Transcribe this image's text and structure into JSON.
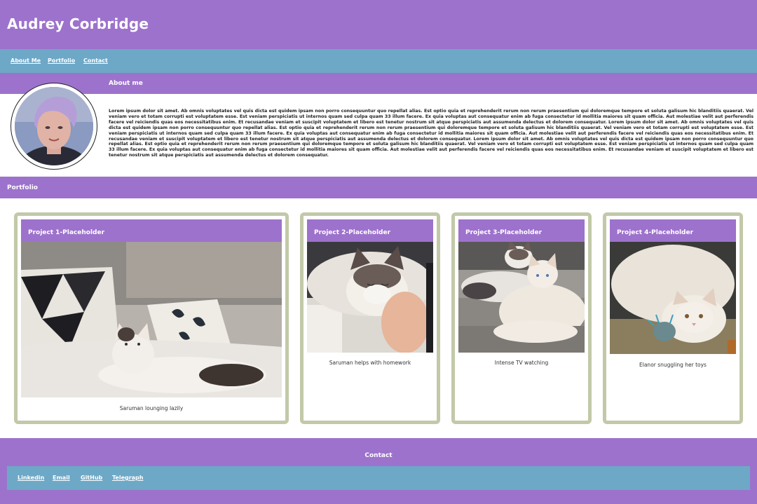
{
  "header": {
    "title": "Audrey Corbridge"
  },
  "nav": {
    "items": [
      {
        "label": "About Me"
      },
      {
        "label": "Portfolio"
      },
      {
        "label": "Contact"
      }
    ]
  },
  "about": {
    "heading": "About me",
    "avatar_icon": "profile-photo",
    "text": "Lorem ipsum dolor sit amet. Ab omnis voluptates vel quis dicta est quidem ipsam non porro consequuntur quo repellat alias. Est optio quia et reprehenderit rerum non rerum praesentium qui doloremque tempore et soluta galisum hic blanditiis quaerat. Vel veniam vero et totam corrupti est voluptatem esse. Est veniam perspiciatis ut internos quam sed culpa quam 33 illum facere. Ex quia voluptas aut consequatur enim ab fuga consectetur id mollitia maiores sit quam officia. Aut molestiae velit aut perferendis facere vel reiciendis quas eos necessitatibus enim. Et recusandae veniam et suscipit voluptatem et libero est tenetur nostrum sit atque perspiciatis aut assumenda delectus et dolorem consequatur. Lorem ipsum dolor sit amet. Ab omnis voluptates vel quis dicta est quidem ipsam non porro consequuntur quo repellat alias. Est optio quia et reprehenderit rerum non rerum praesentium qui doloremque tempore et soluta galisum hic blanditiis quaerat. Vel veniam vero et totam corrupti est voluptatem esse. Est veniam perspiciatis ut internos quam sed culpa quam 33 illum facere. Ex quia voluptas aut consequatur enim ab fuga consectetur id mollitia maiores sit quam officia. Aut molestiae velit aut perferendis facere vel reiciendis quas eos necessitatibus enim. Et recusandae veniam et suscipit voluptatem et libero est tenetur nostrum sit atque perspiciatis aut assumenda delectus et dolorem consequatur. Lorem ipsum dolor sit amet. Ab omnis voluptates vel quis dicta est quidem ipsam non porro consequuntur quo repellat alias. Est optio quia et reprehenderit rerum non rerum praesentium qui doloremque tempore et soluta galisum hic blanditiis quaerat. Vel veniam vero et totam corrupti est voluptatem esse. Est veniam perspiciatis ut internos quam sed culpa quam 33 illum facere. Ex quia voluptas aut consequatur enim ab fuga consectetur id mollitia maiores sit quam officia. Aut molestiae velit aut perferendis facere vel reiciendis quas eos necessitatibus enim. Et recusandae veniam et suscipit voluptatem et libero est tenetur nostrum sit atque perspiciatis aut assumenda delectus et dolorem consequatur."
  },
  "portfolio": {
    "heading": "Portfolio",
    "projects": [
      {
        "title": "Project 1-Placeholder",
        "caption": "Saruman lounging lazily"
      },
      {
        "title": "Project 2-Placeholder",
        "caption": "Saruman helps with homework"
      },
      {
        "title": "Project 3-Placeholder",
        "caption": "Intense TV watching"
      },
      {
        "title": "Project 4-Placeholder",
        "caption": "Elanor snuggling her toys"
      }
    ]
  },
  "footer": {
    "heading": "Contact",
    "links": [
      {
        "label": "Linkedin"
      },
      {
        "label": "Email"
      },
      {
        "label": "GitHub"
      },
      {
        "label": "Telegraph"
      }
    ]
  },
  "colors": {
    "purple": "#9d72cc",
    "blue": "#6ea8c7",
    "card_border": "#c2c9a8"
  }
}
